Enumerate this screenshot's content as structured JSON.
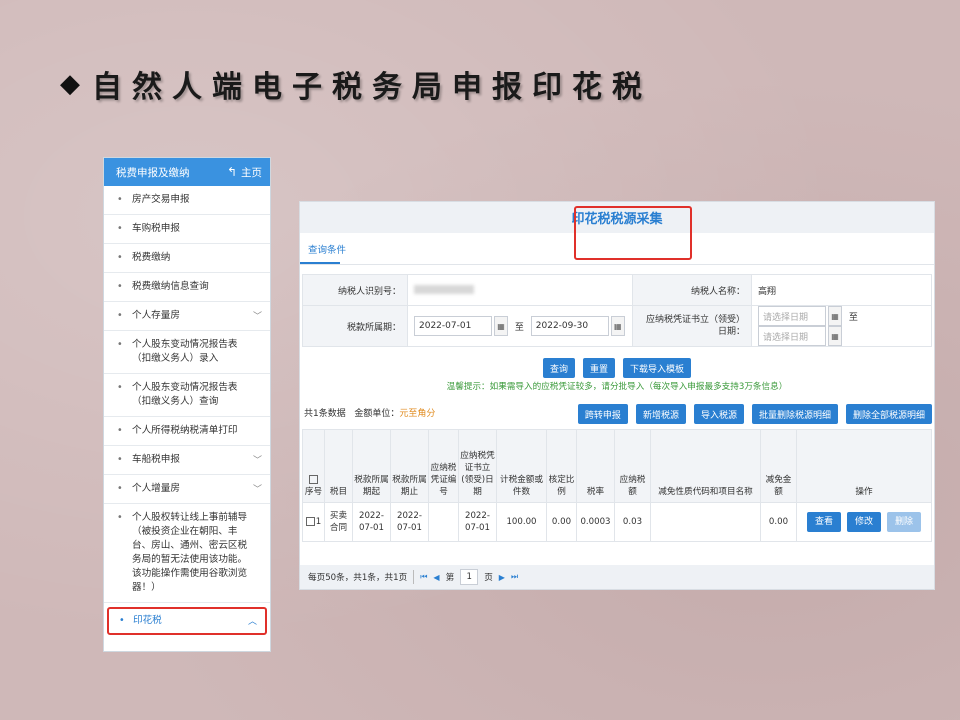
{
  "slide": {
    "title": "自然人端电子税务局申报印花税"
  },
  "sidebar": {
    "header": "税费申报及缴纳",
    "home_label": "主页",
    "items": [
      {
        "label": "房产交易申报",
        "expandable": false
      },
      {
        "label": "车购税申报",
        "expandable": false
      },
      {
        "label": "税费缴纳",
        "expandable": false
      },
      {
        "label": "税费缴纳信息查询",
        "expandable": false
      },
      {
        "label": "个人存量房",
        "expandable": true
      },
      {
        "label": "个人股东变动情况报告表（扣缴义务人）录入",
        "expandable": false
      },
      {
        "label": "个人股东变动情况报告表（扣缴义务人）查询",
        "expandable": false
      },
      {
        "label": "个人所得税纳税清单打印",
        "expandable": false
      },
      {
        "label": "车船税申报",
        "expandable": true
      },
      {
        "label": "个人增量房",
        "expandable": true
      },
      {
        "label": "个人股权转让线上事前辅导（被投资企业在朝阳、丰台、房山、通州、密云区税务局的暂无法使用该功能。该功能操作需使用谷歌浏览器！）",
        "expandable": false
      },
      {
        "label": "印花税",
        "expandable": true,
        "active": true
      }
    ]
  },
  "panel": {
    "title": "印花税税源采集",
    "query_tab": "查询条件",
    "form": {
      "taxpayer_id_label": "纳税人识别号：",
      "taxpayer_name_label": "纳税人名称：",
      "taxpayer_name_value": "高翔",
      "period_label": "税款所属期：",
      "period_start": "2022-07-01",
      "period_end": "2022-09-30",
      "to": "至",
      "cert_date_label": "应纳税凭证书立（领受）日期：",
      "cert_date_placeholder_start": "请选择日期",
      "cert_date_placeholder_end": "请选择日期"
    },
    "buttons": {
      "query": "查询",
      "reset": "重置",
      "download_template": "下载导入模板",
      "cross_declare": "跨转申报",
      "add_source": "新增税源",
      "import_source": "导入税源",
      "batch_delete_detail": "批量删除税源明细",
      "delete_all_detail": "删除全部税源明细"
    },
    "tip": "温馨提示：如果需导入的应税凭证较多，请分批导入（每次导入申报最多支持3万条信息）",
    "summary": {
      "count": "共1条数据",
      "unit_label": "金额单位：",
      "unit_value": "元至角分"
    },
    "table": {
      "headers": [
        "序号",
        "税目",
        "税款所属期起",
        "税款所属期止",
        "应纳税凭证编号",
        "应纳税凭证书立(领受)日期",
        "计税金额或件数",
        "核定比例",
        "税率",
        "应纳税额",
        "减免性质代码和项目名称",
        "减免金额",
        "操作"
      ],
      "rows": [
        {
          "index": "1",
          "item": "买卖合同",
          "start": "2022-07-01",
          "end": "2022-07-01",
          "cert_no": "",
          "cert_date": "2022-07-01",
          "amount": "100.00",
          "ratio": "0.00",
          "rate": "0.0003",
          "tax": "0.03",
          "relief_code": "",
          "relief_amount": "0.00",
          "ops": {
            "view": "查看",
            "edit": "修改",
            "delete": "删除"
          }
        }
      ]
    },
    "pager": {
      "info": "每页50条，共1条，共1页",
      "page_label_pre": "第",
      "page_value": "1",
      "page_label_post": "页"
    }
  }
}
